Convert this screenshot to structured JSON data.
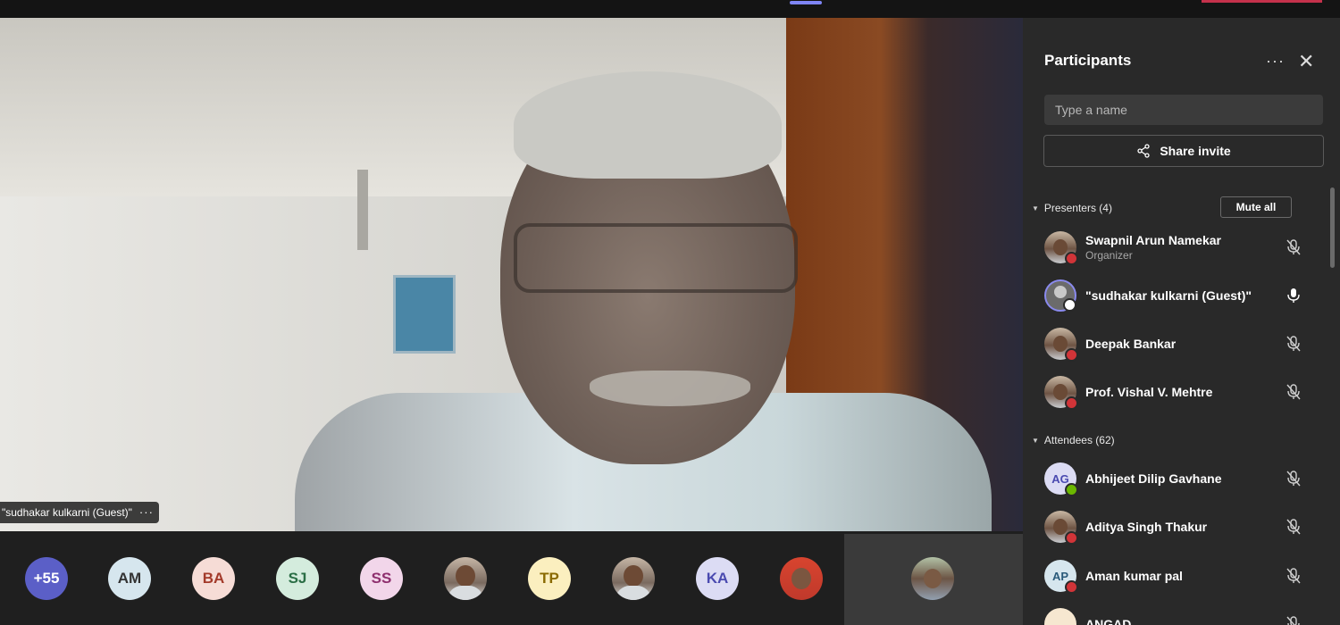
{
  "video": {
    "speaker_name": "\"sudhakar kulkarni (Guest)\"",
    "more_label": "···"
  },
  "gallery": {
    "overflow_count": "+55",
    "tiles": [
      {
        "type": "overflow",
        "label": "+55",
        "bg": "#5b5fc7",
        "fg": "#ffffff"
      },
      {
        "type": "initials",
        "label": "AM",
        "bg": "#d6e6ee",
        "fg": "#333333"
      },
      {
        "type": "initials",
        "label": "BA",
        "bg": "#f6dcd6",
        "fg": "#a33a2a"
      },
      {
        "type": "initials",
        "label": "SJ",
        "bg": "#d4ecdd",
        "fg": "#2a6e45"
      },
      {
        "type": "initials",
        "label": "SS",
        "bg": "#f2d6ea",
        "fg": "#8e2f6e"
      },
      {
        "type": "photo",
        "label": ""
      },
      {
        "type": "initials",
        "label": "TP",
        "bg": "#fbefbf",
        "fg": "#8a6a00"
      },
      {
        "type": "photo",
        "label": ""
      },
      {
        "type": "initials",
        "label": "KA",
        "bg": "#dcdcf4",
        "fg": "#4a4ab0"
      },
      {
        "type": "photo-red",
        "label": ""
      }
    ]
  },
  "panel": {
    "title": "Participants",
    "more_label": "···",
    "close_label": "✕",
    "search_placeholder": "Type a name",
    "share_label": "Share invite",
    "presenters_header": "Presenters (4)",
    "mute_all_label": "Mute all",
    "attendees_header": "Attendees (62)",
    "presenters": [
      {
        "name": "Swapnil Arun Namekar",
        "role": "Organizer",
        "avatar": "photo",
        "status": "#d13438",
        "mic": "muted"
      },
      {
        "name": "\"sudhakar kulkarni (Guest)\"",
        "role": "",
        "avatar": "guest",
        "status": "#ffffff",
        "mic": "on"
      },
      {
        "name": "Deepak Bankar",
        "role": "",
        "avatar": "photo",
        "status": "#d13438",
        "mic": "muted"
      },
      {
        "name": "Prof. Vishal V. Mehtre",
        "role": "",
        "avatar": "photo",
        "status": "#d13438",
        "mic": "muted"
      }
    ],
    "attendees": [
      {
        "name": "Abhijeet Dilip Gavhane",
        "initials": "AG",
        "avatar": "initials",
        "bg": "#dcdcf4",
        "fg": "#4a4ab0",
        "status": "#6bb700",
        "mic": "muted"
      },
      {
        "name": "Aditya Singh Thakur",
        "initials": "",
        "avatar": "photo",
        "status": "#d13438",
        "mic": "muted"
      },
      {
        "name": "Aman kumar pal",
        "initials": "AP",
        "avatar": "initials",
        "bg": "#d6e6ee",
        "fg": "#2a5a7a",
        "status": "#d13438",
        "mic": "muted"
      },
      {
        "name": "ANGAD",
        "initials": "",
        "avatar": "initials",
        "bg": "#f6e7d0",
        "fg": "#8a5a20",
        "status": "",
        "mic": "muted"
      }
    ]
  },
  "colors": {
    "accent": "#5b5fc7",
    "busy": "#d13438",
    "available": "#6bb700"
  }
}
